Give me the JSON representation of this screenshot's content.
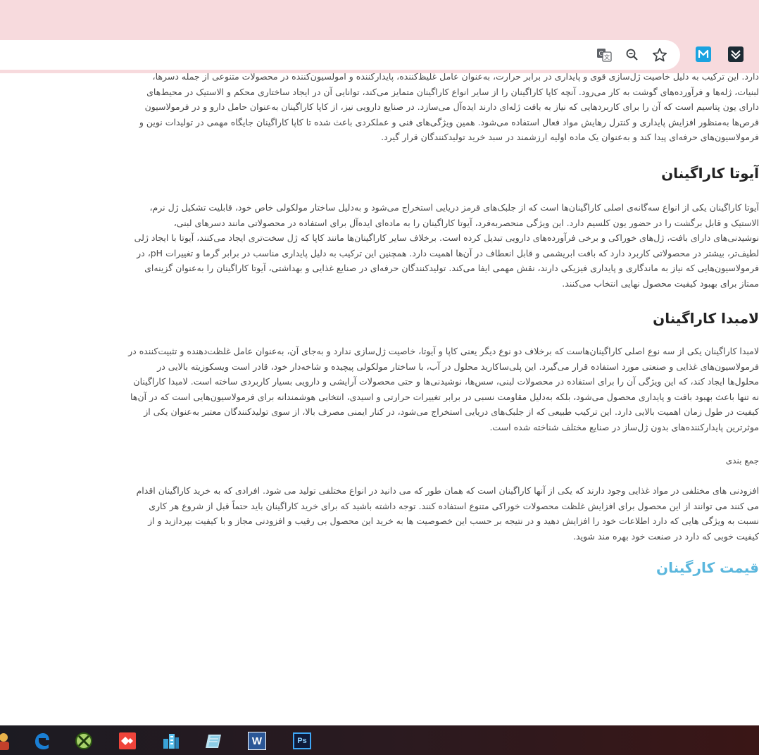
{
  "browser": {
    "icons": [
      "translate-icon",
      "zoom-icon",
      "bookmark-star-icon"
    ],
    "extensions": [
      "m-extension-icon",
      "code-extension-icon"
    ],
    "colors": {
      "frame": "#f7dadd"
    }
  },
  "article": {
    "intro_fragment": "دارد. این ترکیب به دلیل خاصیت ژل‌سازی قوی و پایداری در برابر حرارت، به‌عنوان عامل غلیظ‌کننده، پایدارکننده و امولسیون‌کننده در محصولات متنوعی از جمله دسرها، لبنیات، ژله‌ها و فرآورده‌های گوشت به کار می‌رود. آنچه کاپا کاراگینان را از سایر انواع کاراگینان متمایز می‌کند، توانایی آن در ایجاد ساختاری محکم و الاستیک در محیط‌های دارای یون پتاسیم است که آن را برای کاربردهایی که نیاز به بافت ژله‌ای دارند ایده‌آل می‌سازد. در صنایع دارویی نیز، از کاپا کاراگینان به‌عنوان حامل دارو و در فرمولاسیون قرص‌ها به‌منظور افزایش پایداری و کنترل رهایش مواد فعال استفاده می‌شود. همین ویژگی‌های فنی و عملکردی باعث شده تا کاپا کاراگینان جایگاه مهمی در تولیدات نوین و فرمولاسیون‌های حرفه‌ای پیدا کند و به‌عنوان یک ماده اولیه ارزشمند در سبد خرید تولیدکنندگان قرار گیرد.",
    "iota_heading": "آیوتا کاراگینان",
    "iota_text": "آیوتا کاراگینان یکی از انواع سه‌گانه‌ی اصلی کاراگینان‌ها است که از جلبک‌های قرمز دریایی استخراج می‌شود و به‌دلیل ساختار مولکولی خاص خود، قابلیت تشکیل ژل نرم، الاستیک و قابل برگشت را در حضور یون کلسیم دارد. این ویژگی منحصربه‌فرد، آیوتا کاراگینان را به ماده‌ای ایده‌آل برای استفاده در محصولاتی مانند دسرهای لبنی، نوشیدنی‌های دارای بافت، ژل‌های خوراکی و برخی فرآورده‌های دارویی تبدیل کرده است. برخلاف سایر کاراگینان‌ها مانند کاپا که ژل سخت‌تری ایجاد می‌کنند، آیوتا با ایجاد ژلی لطیف‌تر، بیشتر در محصولاتی کاربرد دارد که بافت ابریشمی و قابل انعطاف در آن‌ها اهمیت دارد. همچنین این ترکیب به دلیل پایداری مناسب در برابر گرما و تغییرات pH، در فرمولاسیون‌هایی که نیاز به ماندگاری و پایداری فیزیکی دارند، نقش مهمی ایفا می‌کند. تولیدکنندگان حرفه‌ای در صنایع غذایی و بهداشتی، آیوتا کاراگینان را به‌عنوان گزینه‌ای ممتاز برای بهبود کیفیت محصول نهایی انتخاب می‌کنند.",
    "lambda_heading": "لامبدا کاراگینان",
    "lambda_text": "لامبدا کاراگینان یکی از سه نوع اصلی کاراگینان‌هاست که برخلاف دو نوع دیگر یعنی کاپا و آیوتا، خاصیت ژل‌سازی ندارد و به‌جای آن، به‌عنوان عامل غلظت‌دهنده و تثبیت‌کننده در فرمولاسیون‌های غذایی و صنعتی مورد استفاده قرار می‌گیرد. این پلی‌ساکارید محلول در آب، با ساختار مولکولی پیچیده و شاخه‌دار خود، قادر است ویسکوزیته بالایی در محلول‌ها ایجاد کند، که این ویژگی آن را برای استفاده در محصولات لبنی، سس‌ها، نوشیدنی‌ها و حتی محصولات آرایشی و دارویی بسیار کاربردی ساخته است. لامبدا کاراگینان نه تنها باعث بهبود بافت و پایداری محصول می‌شود، بلکه به‌دلیل مقاومت نسبی در برابر تغییرات حرارتی و اسیدی، انتخابی هوشمندانه برای فرمولاسیون‌هایی است که در آن‌ها کیفیت در طول زمان اهمیت بالایی دارد. این ترکیب طبیعی که از جلبک‌های دریایی استخراج می‌شود، در کنار ایمنی مصرف بالا، از سوی تولیدکنندگان معتبر به‌عنوان یکی از موثرترین پایدارکننده‌های بدون ژل‌ساز در صنایع مختلف شناخته شده است.",
    "summary_heading": "جمع بندی",
    "summary_text": "افزودنی های مختلفی در مواد غذایی وجود دارند که یکی از آنها کاراگینان است که همان طور که می دانید در انواع مختلفی تولید می شود. افرادی که به خرید کاراگینان اقدام می کنند می توانند از این محصول برای افزایش غلظت محصولات خوراکی متنوع استفاده کنند. توجه داشته باشید که برای خرید کاراگینان باید حتماً قبل از شروع هر کاری نسبت به ویژگی هایی که دارد اطلاعات خود را افزایش دهید و در نتیجه بر حسب این خصوصیت ها به خرید این محصول بی رقیب و افزودنی مجاز و با کیفیت بپردازید و از کیفیت خوبی که دارد در صنعت خود بهره مند شوید.",
    "price_heading": "قیمت کارگینان",
    "price_color": "#5bb7dd"
  },
  "taskbar": {
    "icons": [
      "person-icon",
      "edge-icon",
      "xbox-icon",
      "anydesk-icon",
      "city-app-icon",
      "notes-app-icon",
      "word-icon",
      "photoshop-icon"
    ],
    "word_label": "W",
    "photoshop_label": "Ps"
  }
}
